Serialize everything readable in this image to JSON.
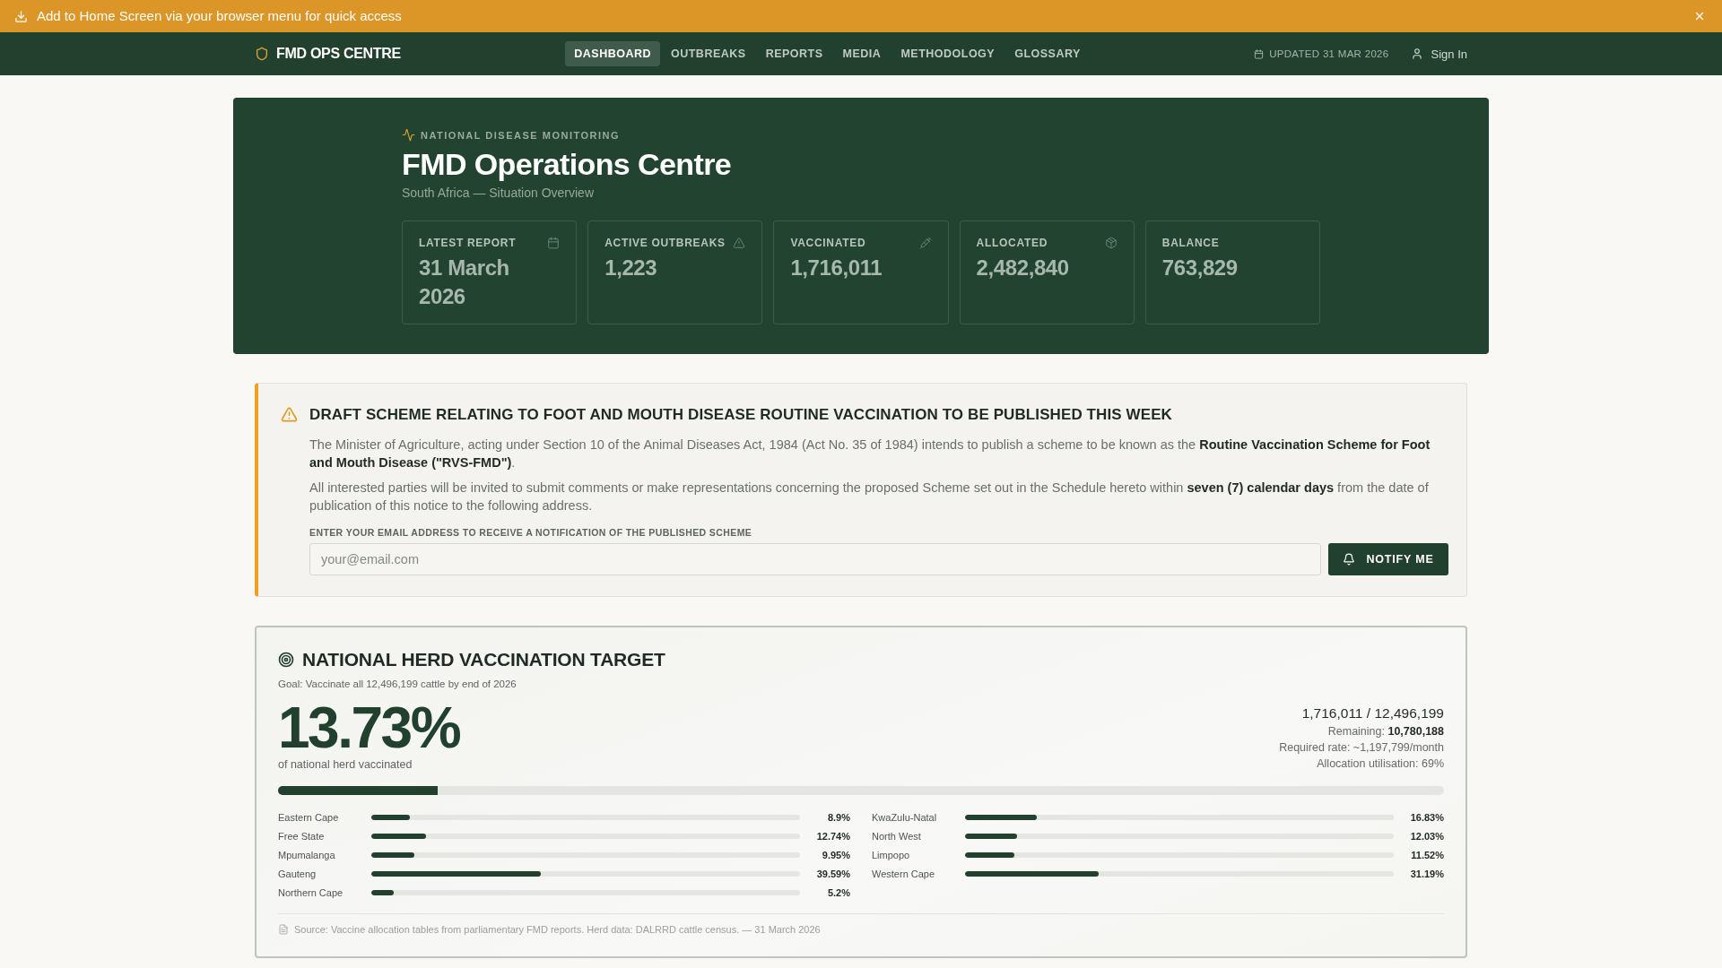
{
  "install_banner": {
    "text": "Add to Home Screen via your browser menu for quick access"
  },
  "nav": {
    "brand": "FMD OPS CENTRE",
    "tabs": [
      {
        "label": "DASHBOARD",
        "selected": true
      },
      {
        "label": "OUTBREAKS",
        "selected": false
      },
      {
        "label": "REPORTS",
        "selected": false
      },
      {
        "label": "MEDIA",
        "selected": false
      },
      {
        "label": "METHODOLOGY",
        "selected": false
      },
      {
        "label": "GLOSSARY",
        "selected": false
      }
    ],
    "updated": "UPDATED 31 MAR 2026",
    "sign_in": "Sign In"
  },
  "hero": {
    "eyebrow": "NATIONAL DISEASE MONITORING",
    "title": "FMD Operations Centre",
    "subtitle": "South Africa — Situation Overview",
    "stats": [
      {
        "kind": "date",
        "label": "LATEST REPORT",
        "value": "31 March 2026"
      },
      {
        "kind": "outbreaks",
        "label": "ACTIVE OUTBREAKS",
        "value": "1,223"
      },
      {
        "kind": "vaccinated",
        "label": "VACCINATED",
        "value": "1,716,011"
      },
      {
        "kind": "allocated",
        "label": "ALLOCATED",
        "value": "2,482,840"
      },
      {
        "kind": "balance",
        "label": "BALANCE",
        "value": "763,829"
      }
    ]
  },
  "notice": {
    "title": "DRAFT SCHEME RELATING TO FOOT AND MOUTH DISEASE ROUTINE VACCINATION TO BE PUBLISHED THIS WEEK",
    "paragraphs": [
      "The Minister of Agriculture, acting under Section 10 of the Animal Diseases Act, 1984 (Act No. 35 of 1984) intends to publish a scheme to be known as the **Routine Vaccination Scheme for Foot and Mouth Disease (\"RVS-FMD\")**.",
      "All interested parties will be invited to submit comments or make representations concerning the proposed Scheme set out in the Schedule hereto within **seven (7) calendar days** from the date of publication of this notice to the following address."
    ],
    "email_label": "ENTER YOUR EMAIL ADDRESS TO RECEIVE A NOTIFICATION OF THE PUBLISHED SCHEME",
    "email_field": {
      "placeholder": "your@email.com"
    },
    "button": "NOTIFY ME"
  },
  "target": {
    "title": "NATIONAL HERD VACCINATION TARGET",
    "goal": "Goal: Vaccinate all 12,496,199 cattle by end of 2026",
    "percent": "13.73%",
    "percent_caption": "of national herd vaccinated",
    "totals": "1,716,011 / 12,496,199",
    "details": [
      "Remaining: **10,780,188**",
      "Required rate: ~1,197,799/month",
      "Allocation utilisation: 69%"
    ],
    "progress": {
      "level": 0.1373
    },
    "provinces": [
      {
        "name": "Eastern Cape",
        "value": "8.9%",
        "level": 0.089
      },
      {
        "name": "KwaZulu-Natal",
        "value": "16.83%",
        "level": 0.1683
      },
      {
        "name": "Free State",
        "value": "12.74%",
        "level": 0.1274
      },
      {
        "name": "North West",
        "value": "12.03%",
        "level": 0.1203
      },
      {
        "name": "Mpumalanga",
        "value": "9.95%",
        "level": 0.0995
      },
      {
        "name": "Limpopo",
        "value": "11.52%",
        "level": 0.1152
      },
      {
        "name": "Gauteng",
        "value": "39.59%",
        "level": 0.3959
      },
      {
        "name": "Western Cape",
        "value": "31.19%",
        "level": 0.3119
      },
      {
        "name": "Northern Cape",
        "value": "5.2%",
        "level": 0.052
      }
    ],
    "source": "Source: Vaccine allocation tables from parliamentary FMD reports. Herd data: DALRRD cattle census. — 31 March 2026"
  }
}
